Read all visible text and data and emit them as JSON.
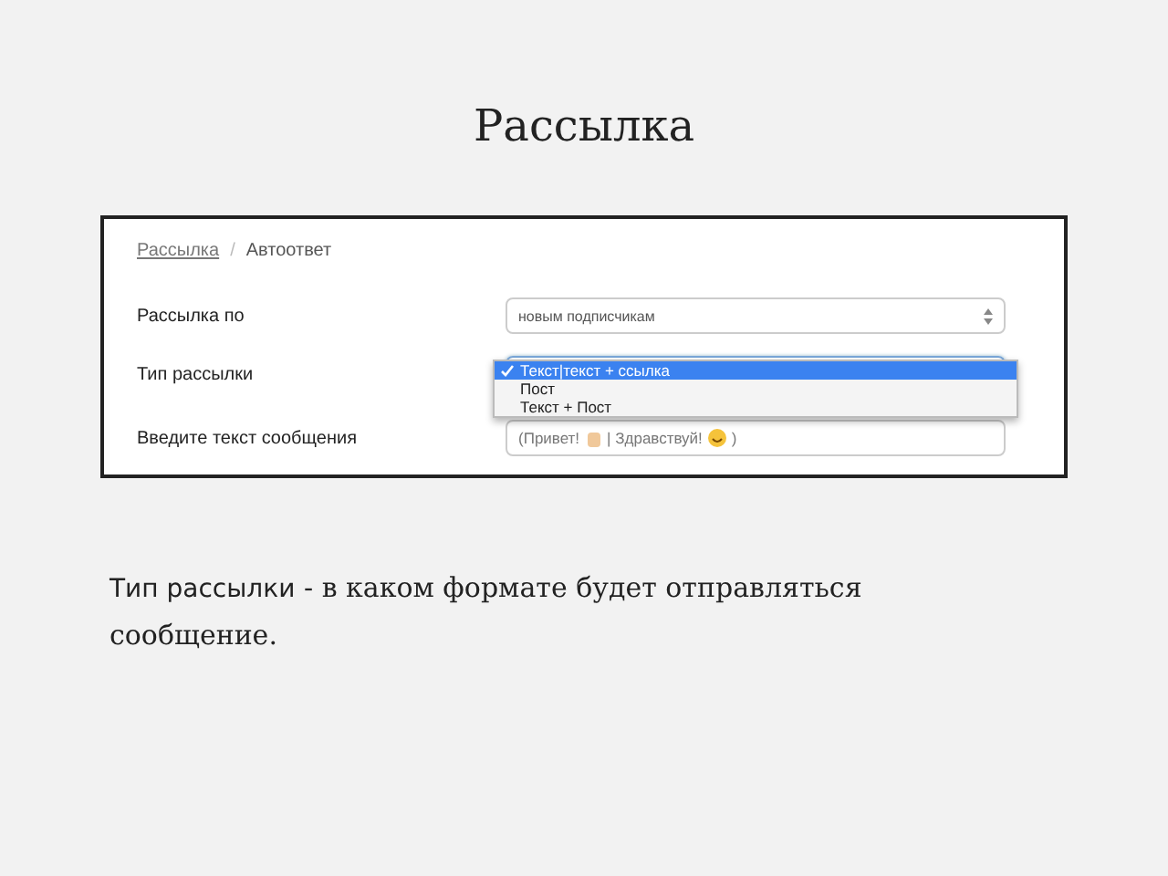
{
  "slide_title": "Рассылка",
  "breadcrumb": [
    {
      "label": "Рассылка",
      "link": true
    },
    {
      "label": "Автоответ",
      "link": false
    }
  ],
  "breadcrumb_separator": "/",
  "form": {
    "audience": {
      "label": "Рассылка по",
      "value": "новым подписчикам"
    },
    "type": {
      "label": "Тип рассылки",
      "options": [
        {
          "label": "Текст|текст + ссылка",
          "selected": true
        },
        {
          "label": "Пост",
          "selected": false
        },
        {
          "label": "Текст + Пост",
          "selected": false
        }
      ]
    },
    "message": {
      "label": "Введите текст сообщения",
      "parts": [
        "(Привет!",
        "| Здравствуй!",
        ")"
      ]
    }
  },
  "caption": {
    "term": "Тип рассылки",
    "separator": "-",
    "text": "в каком формате будет отправляться сообщение."
  }
}
